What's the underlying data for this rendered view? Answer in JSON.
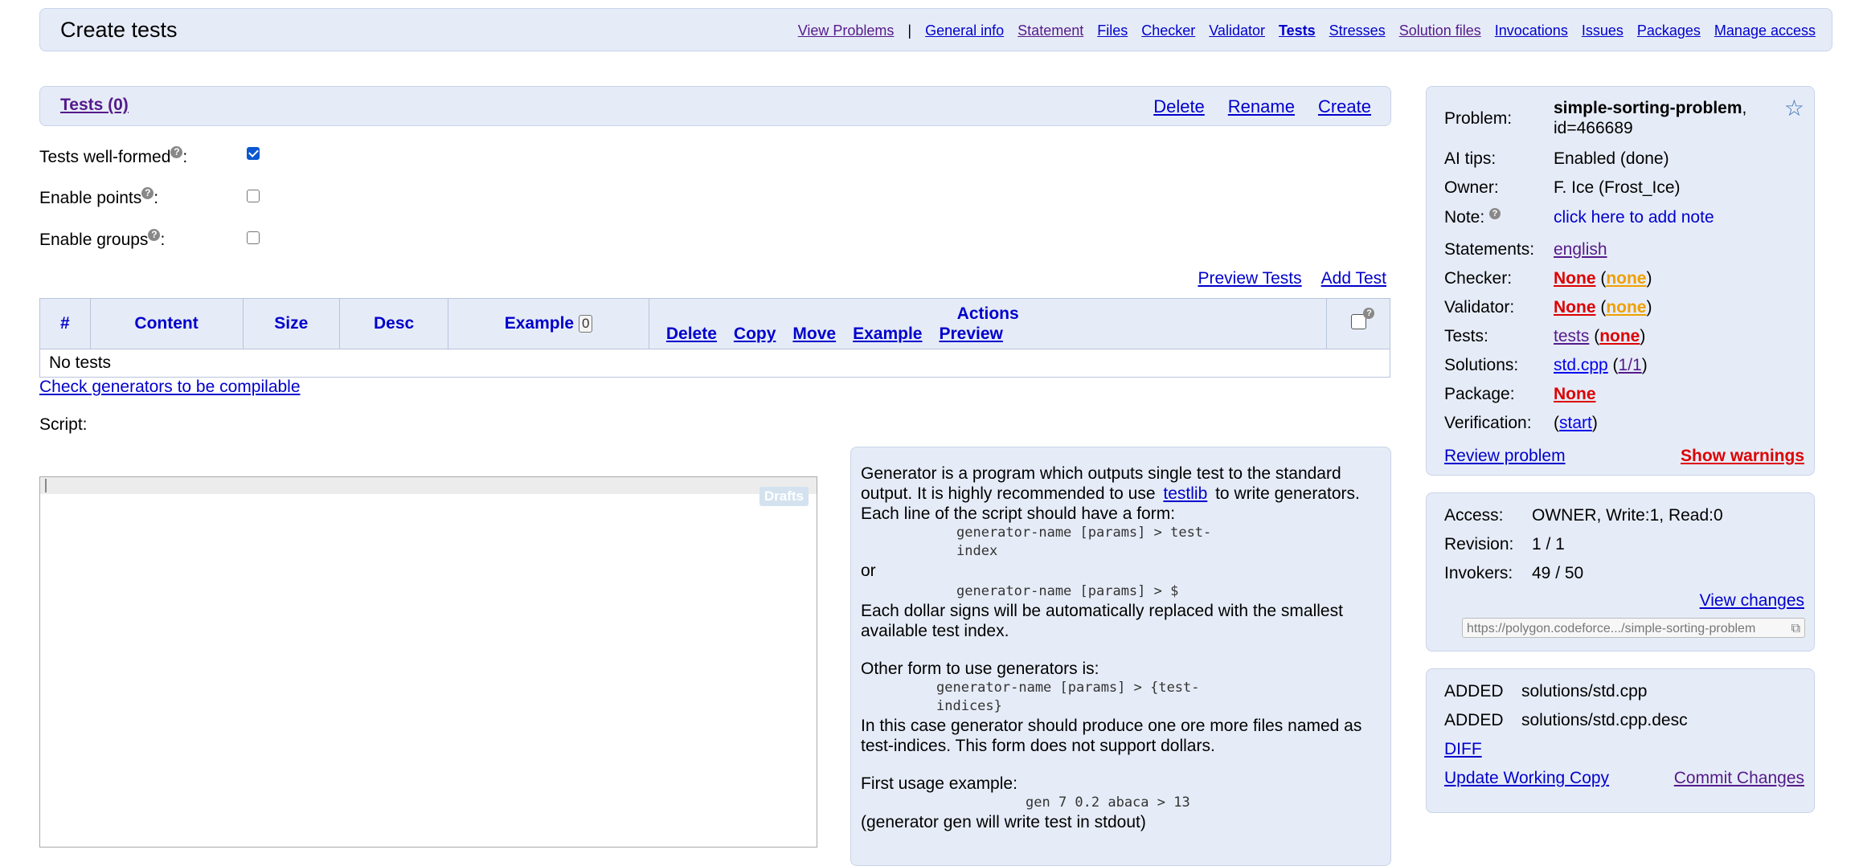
{
  "header": {
    "title": "Create tests",
    "nav": [
      {
        "label": "View Problems",
        "style": "visited"
      },
      {
        "label": "|",
        "style": "sep"
      },
      {
        "label": "General info",
        "style": "link"
      },
      {
        "label": "Statement",
        "style": "visited"
      },
      {
        "label": "Files",
        "style": "link"
      },
      {
        "label": "Checker",
        "style": "link"
      },
      {
        "label": "Validator",
        "style": "link"
      },
      {
        "label": "Tests",
        "style": "active"
      },
      {
        "label": "Stresses",
        "style": "link"
      },
      {
        "label": "Solution files",
        "style": "visited"
      },
      {
        "label": "Invocations",
        "style": "link"
      },
      {
        "label": "Issues",
        "style": "link"
      },
      {
        "label": "Packages",
        "style": "link"
      },
      {
        "label": "Manage access",
        "style": "link"
      }
    ]
  },
  "tests_bar": {
    "title": "Tests (0)",
    "delete": "Delete",
    "rename": "Rename",
    "create": "Create"
  },
  "options": {
    "well_formed": {
      "label": "Tests well-formed",
      "checked": true
    },
    "enable_points": {
      "label": "Enable points",
      "checked": false
    },
    "enable_groups": {
      "label": "Enable groups",
      "checked": false
    },
    "help_mark": "?",
    "colon": ":"
  },
  "test_links": {
    "preview": "Preview Tests",
    "add": "Add Test"
  },
  "table": {
    "columns": {
      "num": "#",
      "content": "Content",
      "size": "Size",
      "desc": "Desc",
      "example": "Example",
      "example_count": "0",
      "actions": "Actions"
    },
    "actions": [
      "Delete",
      "Copy",
      "Move",
      "Example",
      "Preview"
    ],
    "empty": "No tests"
  },
  "check_generators": "Check generators to be compilable",
  "script_label": "Script:",
  "editor": {
    "drafts": "Drafts"
  },
  "help": {
    "p1_a": "Generator is a program which outputs single test to the standard output. It is highly recommended to use",
    "p1_link": "testlib",
    "p1_b": "to write generators.",
    "p2": "Each line of the script should have a form:",
    "code1a": "generator-name [params] > test-",
    "code1b": "index",
    "or": "or",
    "code2": "generator-name [params] > $",
    "p3": "Each dollar signs will be automatically replaced with the smallest available test index.",
    "p4": "Other form to use generators is:",
    "code3a": "generator-name [params] > {test-",
    "code3b": "indices}",
    "p5": "In this case generator should produce one ore more files named as test-indices. This form does not support dollars.",
    "p6": "First usage example:",
    "code4": "gen 7 0.2 abaca > 13",
    "p7": "(generator gen will write test in stdout)"
  },
  "info": {
    "problem_label": "Problem:",
    "problem_name": "simple-sorting-problem",
    "problem_id": ", id=466689",
    "ai_label": "AI tips:",
    "ai_value": "Enabled (done)",
    "owner_label": "Owner:",
    "owner_value": "F. Ice (Frost_Ice)",
    "note_label": "Note:",
    "note_value": "click here to add note",
    "statements_label": "Statements:",
    "statements_value": "english",
    "checker_label": "Checker:",
    "checker_none": "None",
    "checker_sub": "none",
    "validator_label": "Validator:",
    "validator_none": "None",
    "validator_sub": "none",
    "tests_label": "Tests:",
    "tests_link": "tests",
    "tests_sub": "none",
    "solutions_label": "Solutions:",
    "solutions_link": "std.cpp",
    "solutions_sub": "1/1",
    "package_label": "Package:",
    "package_value": "None",
    "verification_label": "Verification:",
    "verification_link": "start",
    "review": "Review problem",
    "warnings": "Show warnings"
  },
  "access": {
    "access_label": "Access:",
    "access_value": "OWNER, Write:1, Read:0",
    "revision_label": "Revision:",
    "revision_value": "1 / 1",
    "invokers_label": "Invokers:",
    "invokers_value": "49 / 50",
    "view_changes": "View changes",
    "url": "https://polygon.codeforce.../simple-sorting-problem"
  },
  "changes": {
    "rows": [
      {
        "status": "ADDED",
        "file": "solutions/std.cpp"
      },
      {
        "status": "ADDED",
        "file": "solutions/std.cpp.desc"
      }
    ],
    "diff": "DIFF",
    "update": "Update Working Copy",
    "commit": "Commit Changes"
  },
  "colors": {
    "panel": "#e6ecf7",
    "link": "#0000cc",
    "visited": "#551a8b",
    "red": "#dd0000",
    "orange": "#f0a000"
  }
}
